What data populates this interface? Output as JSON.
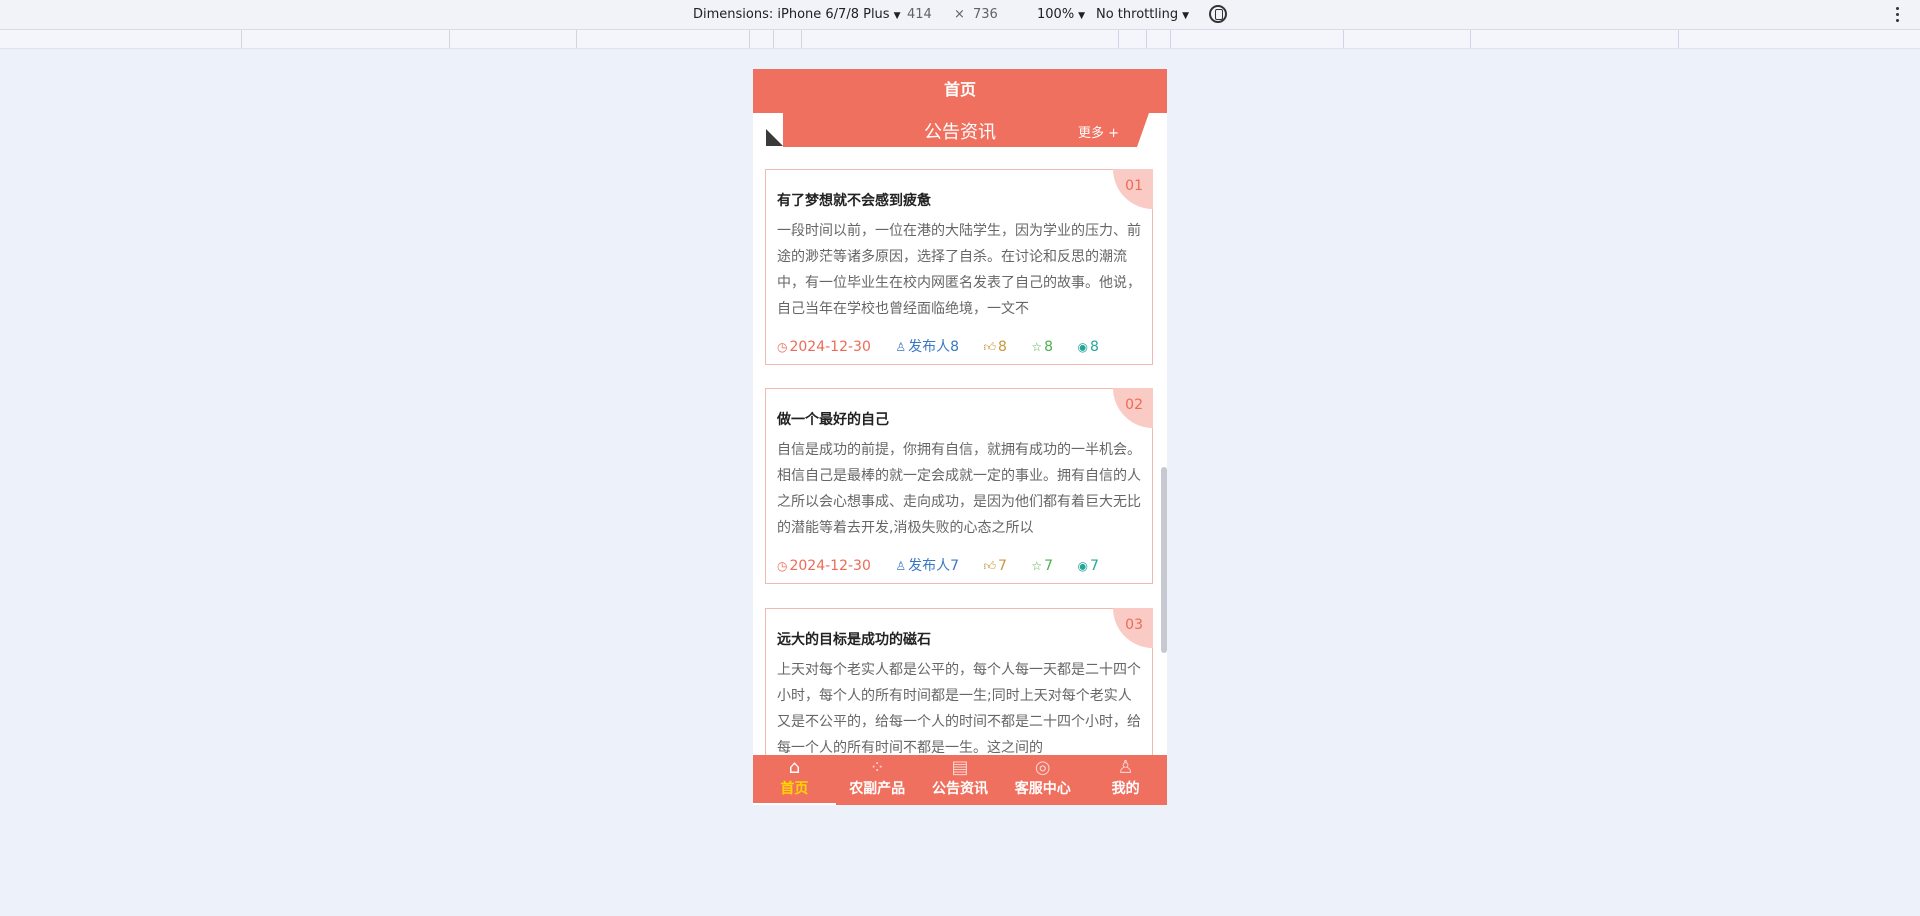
{
  "devtools": {
    "dimensions_label": "Dimensions: iPhone 6/7/8 Plus",
    "width": "414",
    "times": "×",
    "height": "736",
    "zoom": "100%",
    "throttling": "No throttling"
  },
  "app": {
    "header_title": "首页",
    "section_title": "公告资讯",
    "more_label": "更多 +",
    "cards": [
      {
        "index": "01",
        "title": "有了梦想就不会感到疲惫",
        "body": "一段时间以前，一位在港的大陆学生，因为学业的压力、前途的渺茫等诸多原因，选择了自杀。在讨论和反思的潮流中，有一位毕业生在校内网匿名发表了自己的故事。他说，自己当年在学校也曾经面临绝境，一文不",
        "date": "2024-12-30",
        "author": "发布人8",
        "likes": "8",
        "stars": "8",
        "views": "8"
      },
      {
        "index": "02",
        "title": "做一个最好的自己",
        "body": "自信是成功的前提，你拥有自信，就拥有成功的一半机会。相信自己是最棒的就一定会成就一定的事业。拥有自信的人之所以会心想事成、走向成功，是因为他们都有着巨大无比的潜能等着去开发,消极失败的心态之所以",
        "date": "2024-12-30",
        "author": "发布人7",
        "likes": "7",
        "stars": "7",
        "views": "7"
      },
      {
        "index": "03",
        "title": "远大的目标是成功的磁石",
        "body": "上天对每个老实人都是公平的，每个人每一天都是二十四个小时，每个人的所有时间都是一生;同时上天对每个老实人又是不公平的，给每一个人的时间不都是二十四个小时，给每一个人的所有时间不都是一生。这之间的",
        "date": "",
        "author": "",
        "likes": "",
        "stars": "",
        "views": ""
      }
    ],
    "tabs": [
      {
        "label": "首页",
        "icon": "home-icon"
      },
      {
        "label": "农副产品",
        "icon": "grid-icon"
      },
      {
        "label": "公告资讯",
        "icon": "news-icon"
      },
      {
        "label": "客服中心",
        "icon": "headset-icon"
      },
      {
        "label": "我的",
        "icon": "user-icon"
      }
    ]
  }
}
